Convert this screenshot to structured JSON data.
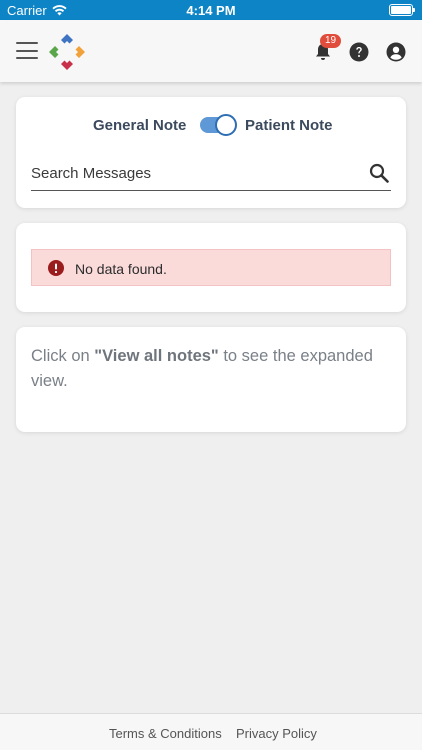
{
  "status_bar": {
    "carrier": "Carrier",
    "time": "4:14 PM"
  },
  "header": {
    "notification_count": "19",
    "icons": [
      "menu-icon",
      "app-logo",
      "bell-icon",
      "help-icon",
      "account-icon"
    ]
  },
  "notes": {
    "general_label": "General Note",
    "patient_label": "Patient Note",
    "toggle_on": true,
    "search_placeholder": "Search Messages"
  },
  "alert": {
    "message": "No data found.",
    "color": "#fbdada"
  },
  "hint": {
    "prefix": "Click on ",
    "link": "\"View all notes\"",
    "suffix": " to see the expanded view."
  },
  "footer": {
    "terms": "Terms & Conditions",
    "privacy": "Privacy Policy"
  },
  "colors": {
    "status_bar": "#0d84c6",
    "toggle": "#5e98d6",
    "badge": "#e14d3c"
  }
}
